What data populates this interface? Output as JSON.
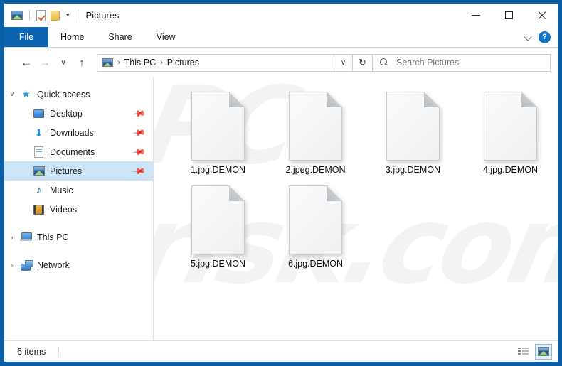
{
  "window": {
    "title": "Pictures",
    "quick_access_toolbar": [
      {
        "name": "pictures-folder-icon",
        "label": "Pictures"
      },
      {
        "name": "properties-icon",
        "label": "Properties"
      },
      {
        "name": "new-folder-icon",
        "label": "New folder"
      },
      {
        "name": "customize-caret-icon",
        "label": "Customize Quick Access Toolbar"
      }
    ],
    "caption": {
      "minimize": "Minimize",
      "maximize": "Maximize",
      "close": "Close"
    },
    "frame_color": "#0b5fa4"
  },
  "ribbon": {
    "file_tab": "File",
    "tabs": [
      "Home",
      "Share",
      "View"
    ],
    "expand_label": "Expand the Ribbon",
    "help_label": "?",
    "accent_color": "#0c64b0"
  },
  "navbar": {
    "back": "←",
    "forward": "→",
    "recent": "∨",
    "up": "↑",
    "breadcrumb": {
      "icon": "pictures-folder-icon",
      "items": [
        "This PC",
        "Pictures"
      ],
      "separator": "›"
    },
    "address_caret": "∨",
    "refresh": "↻"
  },
  "search": {
    "placeholder": "Search Pictures",
    "value": "",
    "icon": "search-icon"
  },
  "sidebar": {
    "items": [
      {
        "label": "Quick access",
        "icon": "star-icon",
        "level": 1,
        "expander": "∨",
        "pinned": false,
        "selected": false
      },
      {
        "label": "Desktop",
        "icon": "desktop-icon",
        "level": 2,
        "expander": "",
        "pinned": true,
        "selected": false
      },
      {
        "label": "Downloads",
        "icon": "download-icon",
        "level": 2,
        "expander": "",
        "pinned": true,
        "selected": false
      },
      {
        "label": "Documents",
        "icon": "documents-icon",
        "level": 2,
        "expander": "",
        "pinned": true,
        "selected": false
      },
      {
        "label": "Pictures",
        "icon": "pictures-icon",
        "level": 2,
        "expander": "",
        "pinned": true,
        "selected": true
      },
      {
        "label": "Music",
        "icon": "music-icon",
        "level": 2,
        "expander": "",
        "pinned": false,
        "selected": false
      },
      {
        "label": "Videos",
        "icon": "videos-icon",
        "level": 2,
        "expander": "",
        "pinned": false,
        "selected": false
      },
      {
        "label": "This PC",
        "icon": "this-pc-icon",
        "level": 1,
        "expander": "›",
        "pinned": false,
        "selected": false
      },
      {
        "label": "Network",
        "icon": "network-icon",
        "level": 1,
        "expander": "›",
        "pinned": false,
        "selected": false
      }
    ],
    "selection_color": "#cce4f7"
  },
  "files": [
    {
      "name": "1.jpg.DEMON",
      "icon": "blank-file-icon"
    },
    {
      "name": "2.jpeg.DEMON",
      "icon": "blank-file-icon"
    },
    {
      "name": "3.jpg.DEMON",
      "icon": "blank-file-icon"
    },
    {
      "name": "4.jpg.DEMON",
      "icon": "blank-file-icon"
    },
    {
      "name": "5.jpg.DEMON",
      "icon": "blank-file-icon"
    },
    {
      "name": "6.jpg.DEMON",
      "icon": "blank-file-icon"
    }
  ],
  "watermark": {
    "line1": "PC",
    "line2": "risk.com"
  },
  "statusbar": {
    "item_count": "6 items",
    "views": [
      {
        "name": "details-view-button",
        "label": "Details",
        "active": false
      },
      {
        "name": "large-icons-view-button",
        "label": "Large icons",
        "active": true
      }
    ]
  }
}
